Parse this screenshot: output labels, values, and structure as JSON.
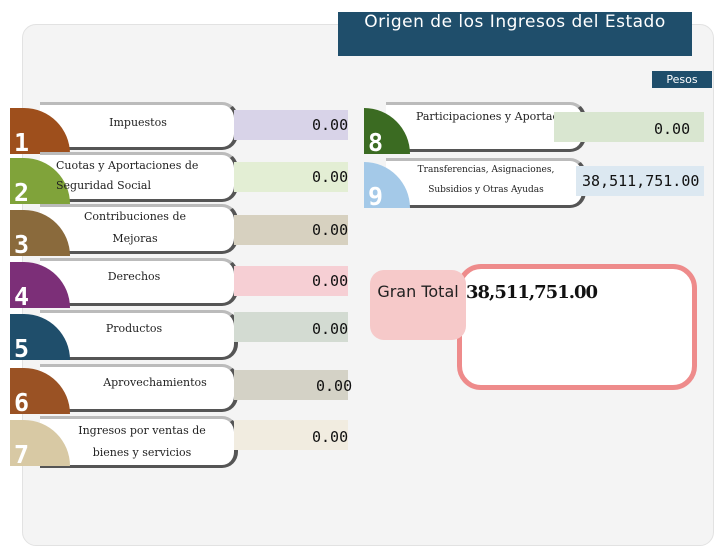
{
  "title": "Origen de los Ingresos del Estado",
  "unit_label": "Pesos",
  "items": [
    {
      "num": "1",
      "label": "Impuestos",
      "value": "0.00",
      "color": "#9e4f1c",
      "box_color": "#d8d3e8"
    },
    {
      "num": "2",
      "label": "Cuotas y Aportaciones de Seguridad Social",
      "value": "0.00",
      "color": "#80a33a",
      "box_color": "#e3eed4"
    },
    {
      "num": "3",
      "label": "Contribuciones de Mejoras",
      "value": "0.00",
      "color": "#8a6a3c",
      "box_color": "#d7d1c0"
    },
    {
      "num": "4",
      "label": "Derechos",
      "value": "0.00",
      "color": "#7c2f78",
      "box_color": "#f6cfd4"
    },
    {
      "num": "5",
      "label": "Productos",
      "value": "0.00",
      "color": "#1f4e6b",
      "box_color": "#d3dbd2"
    },
    {
      "num": "6",
      "label": "Aprovechamientos",
      "value": "0.00",
      "color": "#9a5224",
      "box_color": "#d4d2c6"
    },
    {
      "num": "7",
      "label": "Ingresos por ventas de bienes y servicios",
      "value": "0.00",
      "color": "#d8c9a4",
      "box_color": "#f1ece0"
    },
    {
      "num": "8",
      "label": "Participaciones y Aportaciones",
      "value": "0.00",
      "color": "#3b6b22",
      "box_color": "#d9e6d0"
    },
    {
      "num": "9",
      "label": "Transferencias, Asignaciones, Subsidios y Otras Ayudas",
      "value": "38,511,751.00",
      "color": "#a4c9e8",
      "box_color": "#dce8f1"
    }
  ],
  "gran_total": {
    "label": "Gran Total",
    "value": "38,511,751.00"
  }
}
